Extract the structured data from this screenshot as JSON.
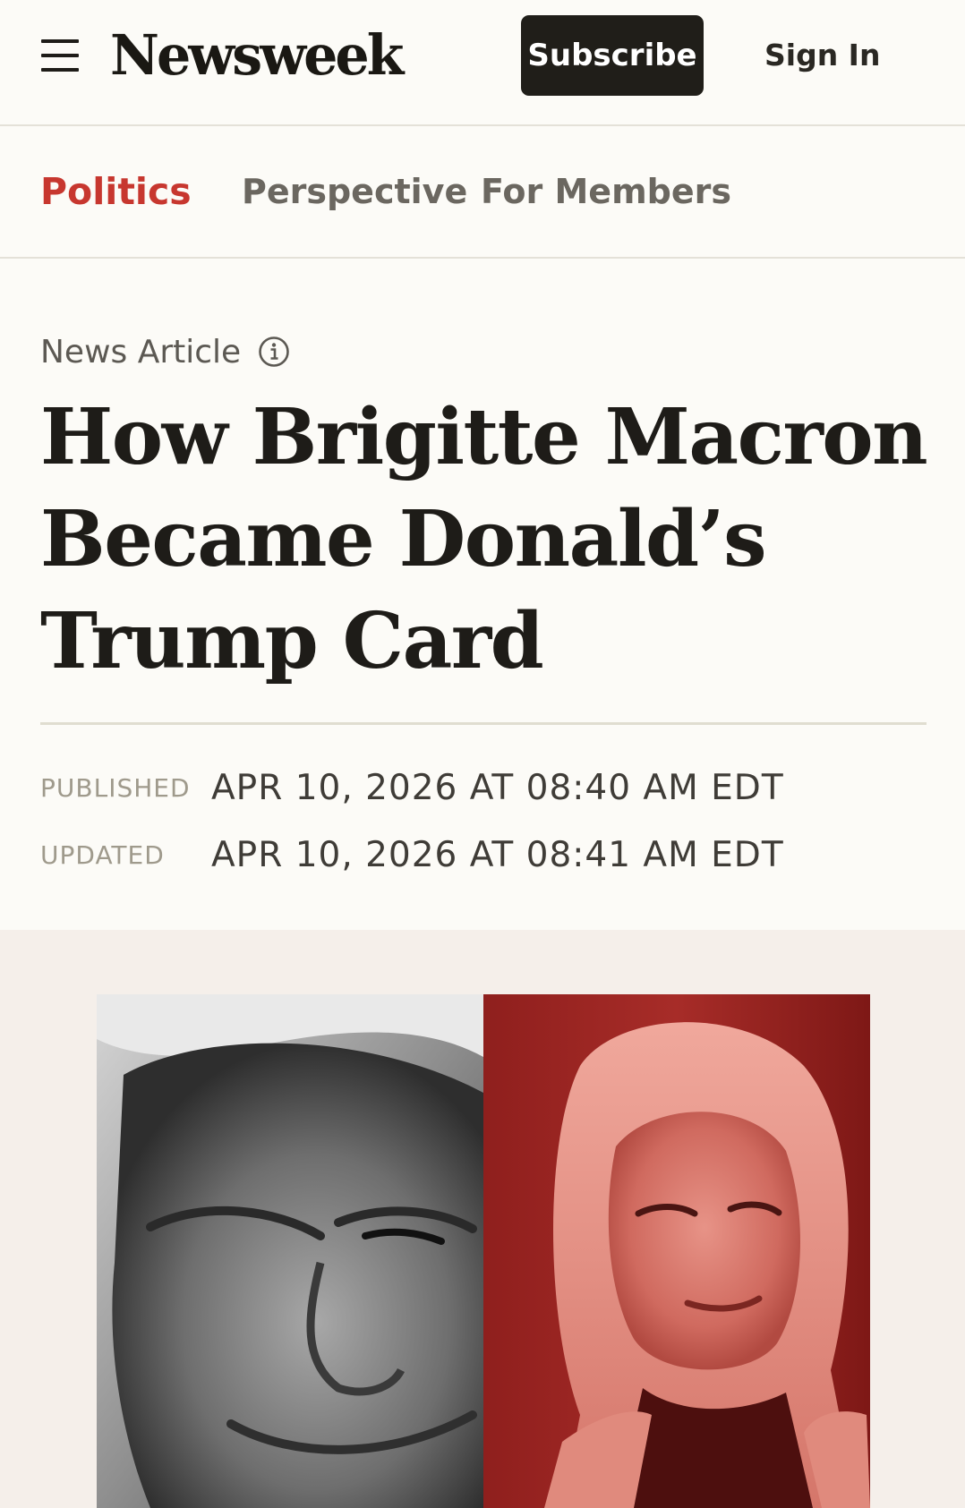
{
  "header": {
    "menu_icon": "hamburger-menu-icon",
    "logo": "Newsweek",
    "subscribe_label": "Subscribe",
    "signin_label": "Sign In",
    "colors": {
      "subscribe_bg": "#201e19",
      "text": "#1e1c18"
    }
  },
  "section_nav": {
    "items": [
      {
        "label": "Politics",
        "active": true
      },
      {
        "label": "Perspective",
        "active": false
      },
      {
        "label": "For Members",
        "active": false
      }
    ],
    "active_color": "#c7372f"
  },
  "article": {
    "type_label": "News Article",
    "info_icon": "info-icon",
    "headline": "How Brigitte Macron Became Donald’s Trump Card",
    "published_label": "PUBLISHED",
    "published_value": "APR 10, 2026 AT 08:40 AM EDT",
    "updated_label": "UPDATED",
    "updated_value": "APR 10, 2026 AT 08:41 AM EDT"
  },
  "hero": {
    "left_tone": "grayscale",
    "right_tone": "red-duotone",
    "band_color": "#f5efea"
  }
}
